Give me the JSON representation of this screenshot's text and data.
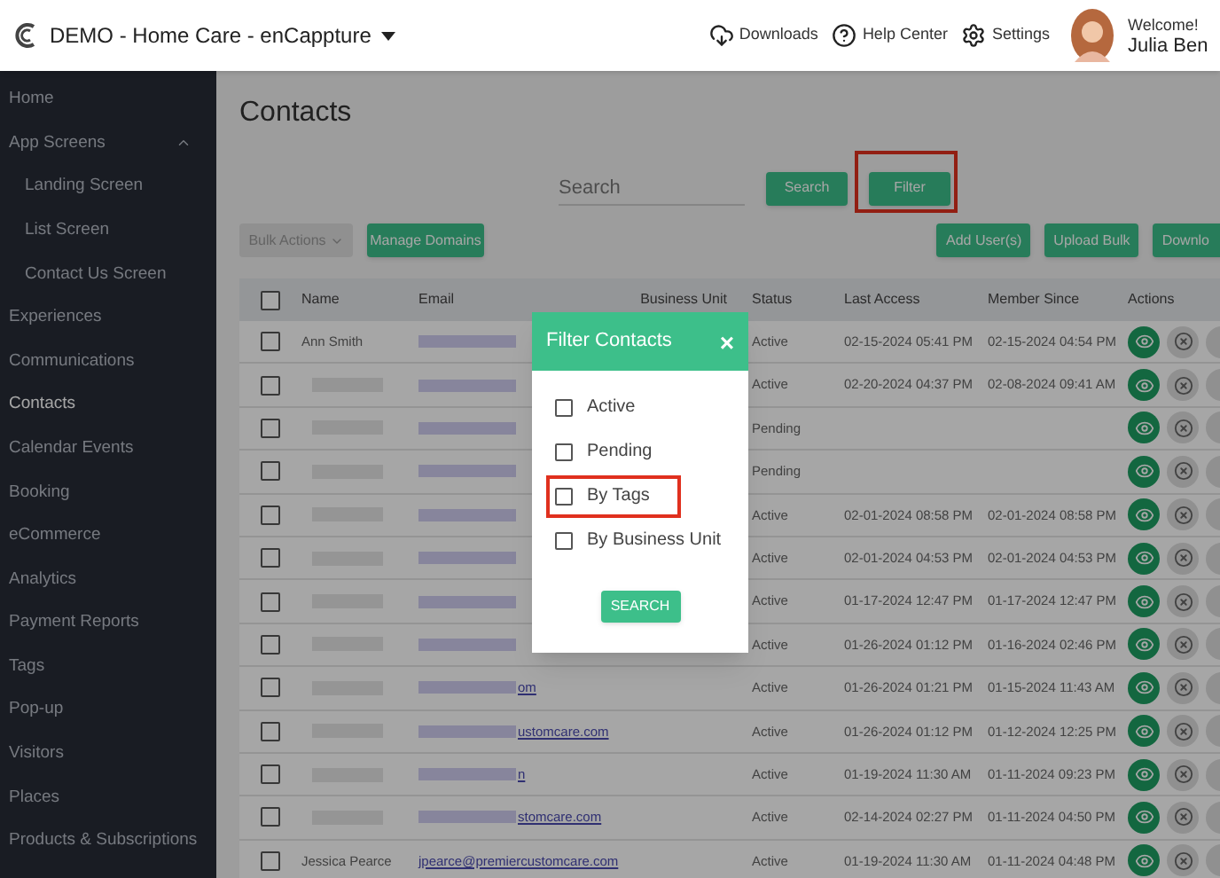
{
  "header": {
    "app_title": "DEMO - Home Care - enCappture",
    "links": [
      {
        "kind": "cloud",
        "label": "Downloads"
      },
      {
        "kind": "help",
        "label": "Help Center"
      },
      {
        "kind": "gear",
        "label": "Settings"
      }
    ],
    "user": {
      "greeting": "Welcome!",
      "name": "Julia Ben"
    }
  },
  "sidebar": {
    "items": [
      {
        "label": "Home",
        "selected": false
      },
      {
        "label": "App Screens",
        "selected": false,
        "expanded": true,
        "children": [
          {
            "label": "Landing Screen",
            "selected": false
          },
          {
            "label": "List Screen",
            "selected": false
          },
          {
            "label": "Contact Us Screen",
            "selected": false
          }
        ]
      },
      {
        "label": "Experiences",
        "selected": false
      },
      {
        "label": "Communications",
        "selected": false
      },
      {
        "label": "Contacts",
        "selected": true
      },
      {
        "label": "Calendar Events",
        "selected": false
      },
      {
        "label": "Booking",
        "selected": false
      },
      {
        "label": "eCommerce",
        "selected": false
      },
      {
        "label": "Analytics",
        "selected": false
      },
      {
        "label": "Payment Reports",
        "selected": false
      },
      {
        "label": "Tags",
        "selected": false
      },
      {
        "label": "Pop-up",
        "selected": false
      },
      {
        "label": "Visitors",
        "selected": false
      },
      {
        "label": "Places",
        "selected": false
      },
      {
        "label": "Products & Subscriptions",
        "selected": false
      }
    ]
  },
  "page": {
    "title": "Contacts",
    "search": {
      "placeholder": "Search"
    },
    "search_button": "Search",
    "filter_button": {
      "label": "Filter",
      "highlighted": true
    },
    "bulk_actions": "Bulk Actions",
    "manage_domains": "Manage Domains",
    "right_buttons": [
      "Add User(s)",
      "Upload Bulk",
      "Downlo"
    ]
  },
  "table": {
    "select_all_checked": false,
    "columns": [
      "Name",
      "Email",
      "Business Unit",
      "Status",
      "Last Access",
      "Member Since",
      "Actions"
    ],
    "rows": [
      {
        "checked": false,
        "name": "Ann Smith",
        "email": "",
        "status": "Active",
        "last_access": "02-15-2024 05:41 PM",
        "member_since": "02-15-2024 04:54 PM"
      },
      {
        "checked": false,
        "name": "",
        "email": "",
        "status": "Active",
        "last_access": "02-20-2024 04:37 PM",
        "member_since": "02-08-2024 09:41 AM"
      },
      {
        "checked": false,
        "name": "",
        "email": "",
        "status": "Pending",
        "last_access": "",
        "member_since": ""
      },
      {
        "checked": false,
        "name": "",
        "email": "",
        "status": "Pending",
        "last_access": "",
        "member_since": ""
      },
      {
        "checked": false,
        "name": "",
        "email": "",
        "status": "Active",
        "last_access": "02-01-2024 08:58 PM",
        "member_since": "02-01-2024 08:58 PM"
      },
      {
        "checked": false,
        "name": "",
        "email": "",
        "status": "Active",
        "last_access": "02-01-2024 04:53 PM",
        "member_since": "02-01-2024 04:53 PM"
      },
      {
        "checked": false,
        "name": "",
        "email": "",
        "status": "Active",
        "last_access": "01-17-2024 12:47 PM",
        "member_since": "01-17-2024 12:47 PM"
      },
      {
        "checked": false,
        "name": "",
        "email": "",
        "status": "Active",
        "last_access": "01-26-2024 01:12 PM",
        "member_since": "01-16-2024 02:46 PM"
      },
      {
        "checked": false,
        "name": "",
        "email": "om",
        "status": "Active",
        "last_access": "01-26-2024 01:21 PM",
        "member_since": "01-15-2024 11:43 AM"
      },
      {
        "checked": false,
        "name": "",
        "email": "ustomcare.com",
        "status": "Active",
        "last_access": "01-26-2024 01:12 PM",
        "member_since": "01-12-2024 12:25 PM"
      },
      {
        "checked": false,
        "name": "",
        "email": "n",
        "status": "Active",
        "last_access": "01-19-2024 11:30 AM",
        "member_since": "01-11-2024 09:23 PM"
      },
      {
        "checked": false,
        "name": "",
        "email": "stomcare.com",
        "status": "Active",
        "last_access": "02-14-2024 02:27 PM",
        "member_since": "01-11-2024 04:50 PM"
      },
      {
        "checked": false,
        "name": "Jessica Pearce",
        "email": "jpearce@premiercustomcare.com",
        "status": "Active",
        "last_access": "01-19-2024 11:30 AM",
        "member_since": "01-11-2024 04:48 PM"
      }
    ]
  },
  "modal": {
    "title": "Filter Contacts",
    "close": "×",
    "options": [
      {
        "label": "Active",
        "checked": false,
        "highlighted": false
      },
      {
        "label": "Pending",
        "checked": false,
        "highlighted": false
      },
      {
        "label": "By Tags",
        "checked": false,
        "highlighted": true
      },
      {
        "label": "By Business Unit",
        "checked": false,
        "highlighted": false
      }
    ],
    "search_button": "SEARCH"
  }
}
